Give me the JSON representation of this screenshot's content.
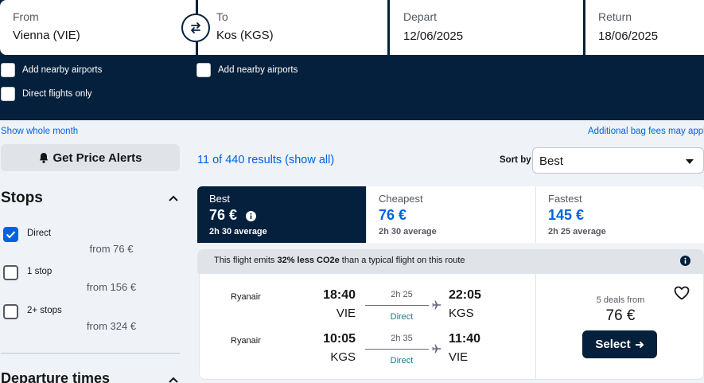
{
  "search": {
    "from_label": "From",
    "from_value": "Vienna (VIE)",
    "to_label": "To",
    "to_value": "Kos (KGS)",
    "depart_label": "Depart",
    "depart_value": "12/06/2025",
    "return_label": "Return",
    "return_value": "18/06/2025",
    "nearby_from": "Add nearby airports",
    "nearby_to": "Add nearby airports",
    "direct_only": "Direct flights only"
  },
  "links": {
    "show_month": "Show whole month",
    "bag_fees": "Additional bag fees may apply"
  },
  "filters": {
    "price_alerts": "Get Price Alerts",
    "stops_heading": "Stops",
    "stops": [
      {
        "label": "Direct",
        "price": "from 76 €",
        "checked": true
      },
      {
        "label": "1 stop",
        "price": "from 156 €",
        "checked": false
      },
      {
        "label": "2+ stops",
        "price": "from 324 €",
        "checked": false
      }
    ],
    "departure_heading": "Departure times"
  },
  "results": {
    "count_text": "11 of 440 results (show all)",
    "sort_label": "Sort by",
    "sort_value": "Best"
  },
  "tabs": [
    {
      "name": "Best",
      "price": "76 €",
      "avg": "2h 30 average",
      "active": true
    },
    {
      "name": "Cheapest",
      "price": "76 €",
      "avg": "2h 30 average",
      "active": false
    },
    {
      "name": "Fastest",
      "price": "145 €",
      "avg": "2h 25 average",
      "active": false
    }
  ],
  "eco": {
    "pre": "This flight emits ",
    "bold": "32% less CO2e",
    "post": " than a typical flight on this route"
  },
  "card": {
    "legs": [
      {
        "airline": "Ryanair",
        "dep_time": "18:40",
        "dep_code": "VIE",
        "duration": "2h 25",
        "stops": "Direct",
        "arr_time": "22:05",
        "arr_code": "KGS"
      },
      {
        "airline": "Ryanair",
        "dep_time": "10:05",
        "dep_code": "KGS",
        "duration": "2h 35",
        "stops": "Direct",
        "arr_time": "11:40",
        "arr_code": "VIE"
      }
    ],
    "deals": "5 deals from",
    "price": "76 €",
    "select": "Select"
  },
  "colors": {
    "navy": "#05203c",
    "accent_blue": "#0062e3",
    "direct_teal": "#0c838a",
    "page_bg": "#eff3f8"
  }
}
